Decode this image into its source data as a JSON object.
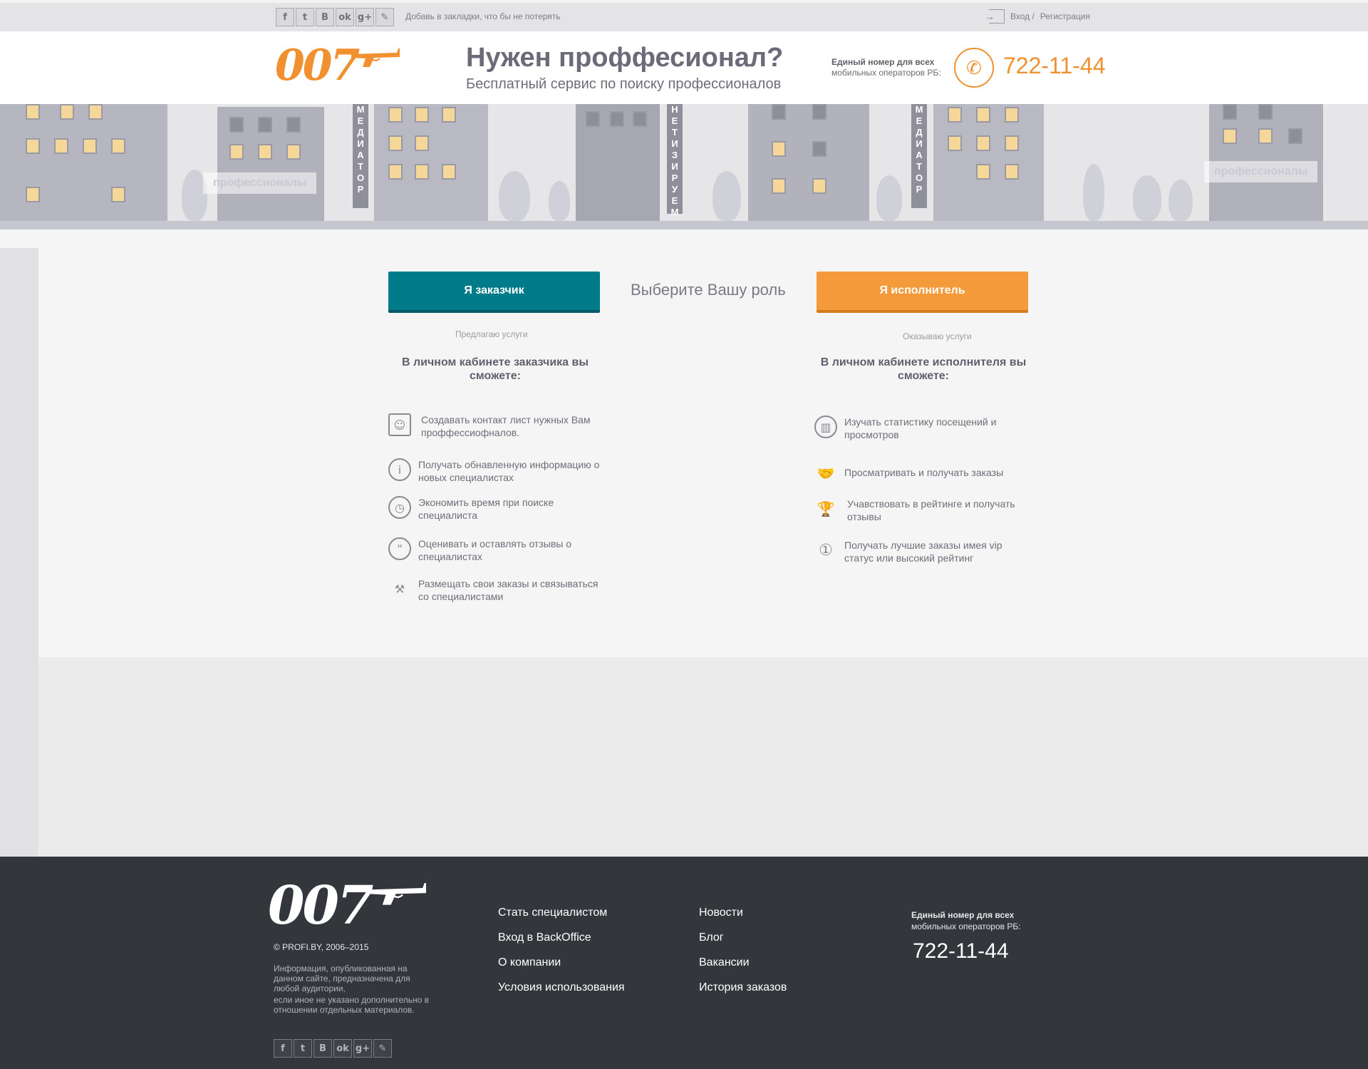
{
  "topbar": {
    "social": [
      {
        "icon": "facebook-icon",
        "glyph": "f"
      },
      {
        "icon": "twitter-icon",
        "glyph": "t"
      },
      {
        "icon": "vk-icon",
        "glyph": "B"
      },
      {
        "icon": "odnoklassniki-icon",
        "glyph": "ok"
      },
      {
        "icon": "google-plus-icon",
        "glyph": "g+"
      },
      {
        "icon": "livejournal-icon",
        "glyph": "✎"
      }
    ],
    "bookmark_text": "Добавь в закладки, что бы не потерять",
    "login_label": "Вход /",
    "register_label": "Регистрация"
  },
  "header": {
    "logo_text": "007",
    "headline": "Нужен проффесионал?",
    "subheadline": "Бесплатный сервис по поиску профессионалов",
    "phone_label_line1": "Единый номер для всех",
    "phone_label_line2": "мобильных операторов РБ:",
    "phone_number": "722-11-44"
  },
  "banner": {
    "signs": [
      "МЕДИАТОР",
      "НЕТИЗИРУЕМ",
      "МЕДИАТОР"
    ],
    "ghost_labels": [
      "профессионалы",
      "профессионалы"
    ]
  },
  "roles": {
    "choose_label": "Выберите Вашу роль",
    "customer": {
      "button_label": "Я заказчик",
      "subtitle": "Предлагаю услуги",
      "heading": "В личном кабинете заказчика вы сможете:",
      "features": [
        {
          "icon": "contact-book-icon",
          "glyph": "☺",
          "text": "Создавать контакт лист нужных Вам проффессиофналов."
        },
        {
          "icon": "info-icon",
          "glyph": "i",
          "text": "Получать обнавленную информацию о новых специалистах"
        },
        {
          "icon": "clock-icon",
          "glyph": "◷",
          "text": "Экономить время при поиске специалиста"
        },
        {
          "icon": "quote-bubble-icon",
          "glyph": "”",
          "text": "Оценивать и оставлять отзывы о специалистах"
        },
        {
          "icon": "hammer-icon",
          "glyph": "⚒",
          "text": "Размещать свои заказы и связываться со специалистами"
        }
      ]
    },
    "executor": {
      "button_label": "Я исполнитель",
      "subtitle": "Оказываю  услуги",
      "heading": "В личном кабинете исполнителя вы сможете:",
      "features": [
        {
          "icon": "stats-bubble-icon",
          "glyph": "▥",
          "text": "Изучать статистику посещений и просмотров"
        },
        {
          "icon": "handshake-icon",
          "glyph": "🤝",
          "text": "Просматривать и получать заказы"
        },
        {
          "icon": "trophy-icon",
          "glyph": "🏆",
          "text": "Учавствовать в рейтинге и получать отзывы"
        },
        {
          "icon": "medal-icon",
          "glyph": "①",
          "text": "Получать лучшие заказы имея vip статус или высокий рейтинг"
        }
      ]
    }
  },
  "footer": {
    "logo_text": "007",
    "copyright": "© PROFI.BY, 2006–2015",
    "info_line1": "Информация, опубликованная на данном сайте, предназначена для любой аудитории,",
    "info_line2": "если иное не указано дополнительно в отношении отдельных материалов.",
    "links_col1": [
      "Стать специалистом",
      "Вход в BackOffice",
      "О компании",
      "Условия использования"
    ],
    "links_col2": [
      "Новости",
      "Блог",
      "Вакансии",
      "История заказов"
    ],
    "phone_label_line1": "Единый номер для всех",
    "phone_label_line2": "мобильных операторов РБ:",
    "phone_number": "722-11-44"
  },
  "colors": {
    "brand_orange": "#f0902f",
    "customer_teal": "#007b8a",
    "footer_bg": "#33363b"
  }
}
